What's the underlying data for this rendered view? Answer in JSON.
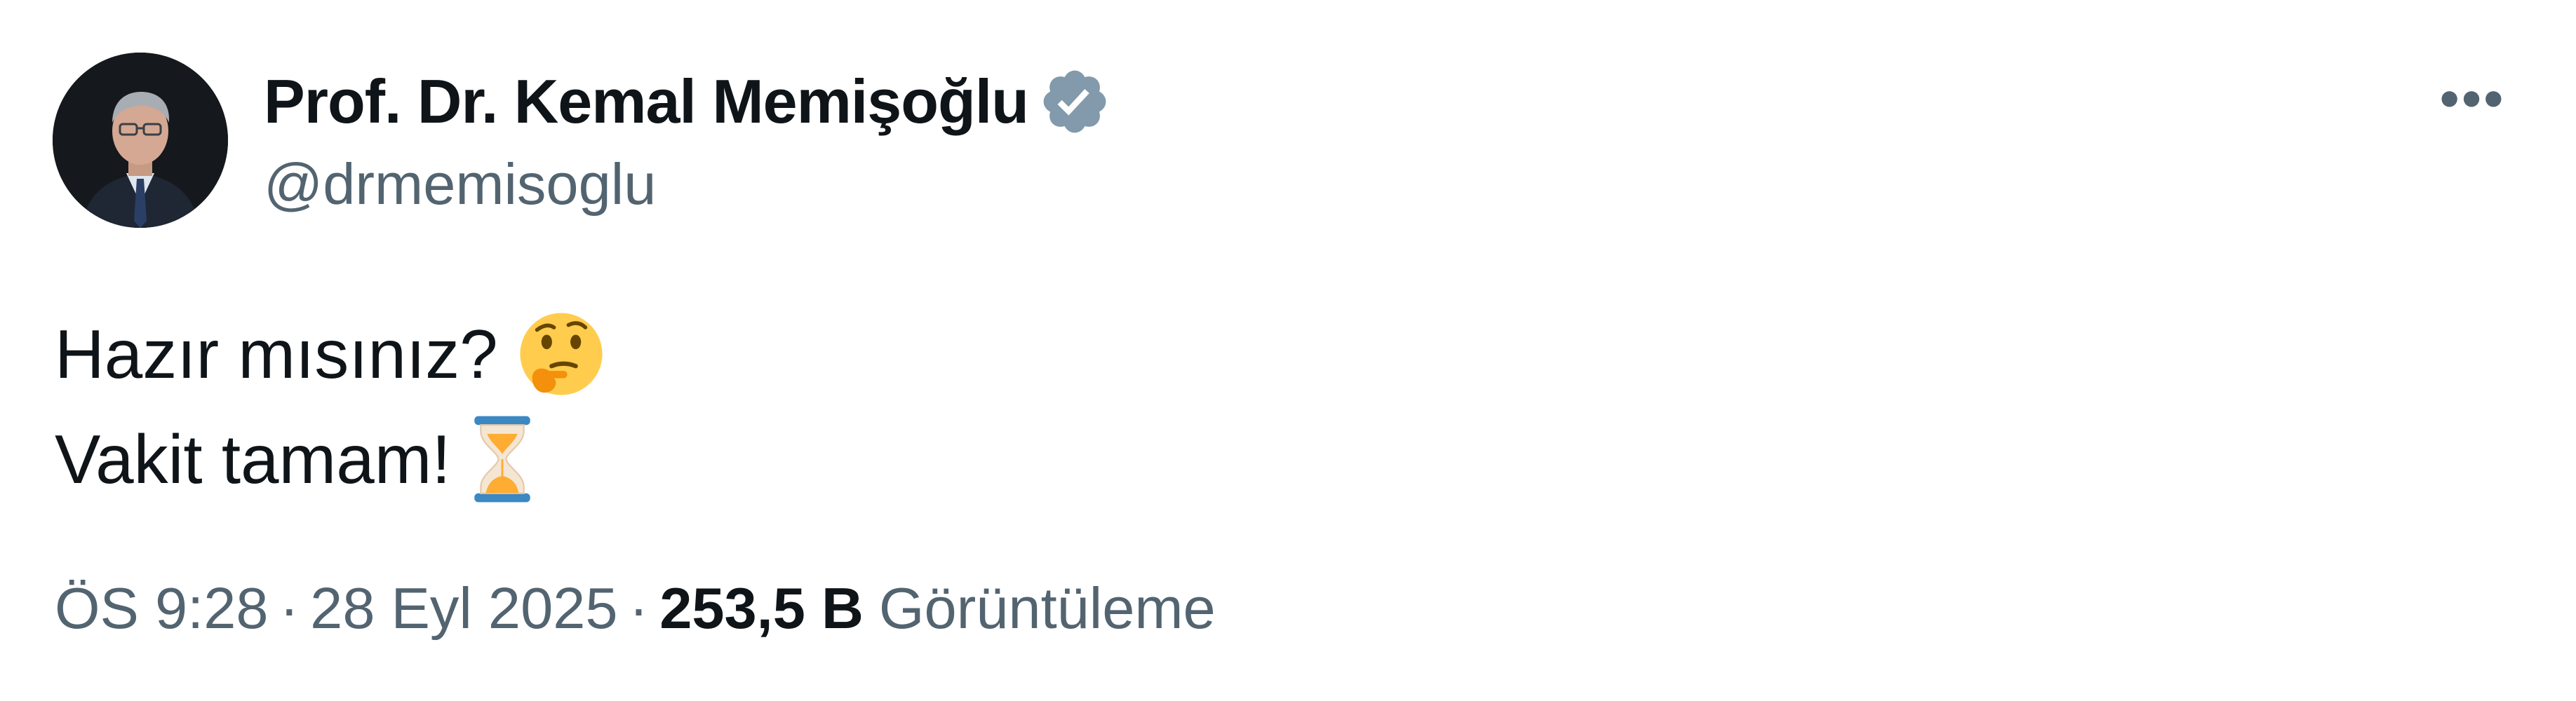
{
  "author": {
    "display_name": "Prof. Dr. Kemal Memişoğlu",
    "handle": "@drmemisoglu",
    "verified": true,
    "verified_color": "#829aab"
  },
  "tweet": {
    "lines": [
      {
        "text": "Hazır mısınız?",
        "emoji": "thinking-face-icon"
      },
      {
        "text": "Vakit tamam!",
        "emoji": "hourglass-icon"
      }
    ]
  },
  "meta": {
    "time": "ÖS 9:28",
    "separator": "·",
    "date": "28 Eyl 2025",
    "views_count": "253,5 B",
    "views_label": "Görüntüleme"
  },
  "more_menu": {
    "icon": "more-horizontal-icon",
    "glyph": "•••"
  },
  "colors": {
    "text_primary": "#0f1419",
    "text_secondary": "#536471",
    "background": "#ffffff"
  }
}
